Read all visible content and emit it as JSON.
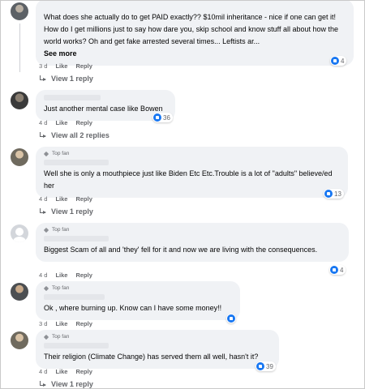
{
  "comments": [
    {
      "top_fan": "",
      "text": "What does she actually do to get PAID exactly?? $10mil inheritance - nice if one can get it! How do I get millions just to say how dare you, skip school and know stuff all about how the world works? Oh and get fake arrested several times... Leftists ar...",
      "see_more": "See more",
      "time": "3 d",
      "like": "Like",
      "reply": "Reply",
      "reactions": "4",
      "replies_link": "View 1 reply"
    },
    {
      "top_fan": "",
      "text": "Just another mental case like Bowen",
      "time": "4 d",
      "like": "Like",
      "reply": "Reply",
      "reactions": "36",
      "replies_link": "View all 2 replies"
    },
    {
      "top_fan": "Top fan",
      "text": "Well she is only a mouthpiece just like Biden Etc Etc.Trouble is a lot of \"adults\" believe/ed her",
      "time": "4 d",
      "like": "Like",
      "reply": "Reply",
      "reactions": "13",
      "replies_link": "View 1 reply"
    },
    {
      "top_fan": "Top fan",
      "text": "Biggest Scam of all and 'they' fell for it and now we are living with the consequences.",
      "time": "4 d",
      "like": "Like",
      "reply": "Reply",
      "reactions": "4",
      "replies_link": ""
    },
    {
      "top_fan": "Top fan",
      "text": "Ok , where burning up. Know can I have some money!!",
      "time": "3 d",
      "like": "Like",
      "reply": "Reply",
      "reactions": "",
      "replies_link": ""
    },
    {
      "top_fan": "Top fan",
      "text": "Their religion (Climate Change) has served them all well, hasn't it?",
      "time": "4 d",
      "like": "Like",
      "reply": "Reply",
      "reactions": "39",
      "replies_link": "View 1 reply"
    }
  ],
  "icons": {
    "reaction": "like-icon",
    "top_fan": "top-fan-badge-icon",
    "reply": "reply-arrow-icon"
  },
  "colors": {
    "bubble": "#f0f2f5",
    "like_blue": "#1877f2",
    "secondary_text": "#65676b"
  }
}
